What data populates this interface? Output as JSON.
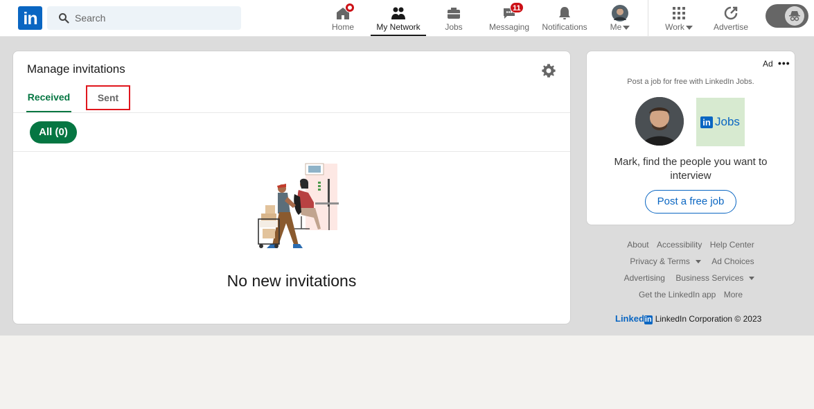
{
  "header": {
    "logo": "in",
    "search_placeholder": "Search",
    "nav": {
      "home": "Home",
      "network": "My Network",
      "jobs": "Jobs",
      "messaging": "Messaging",
      "messaging_badge": "11",
      "notifications": "Notifications",
      "me": "Me",
      "work": "Work",
      "advertise": "Advertise"
    }
  },
  "invitations": {
    "title": "Manage invitations",
    "tabs": [
      "Received",
      "Sent"
    ],
    "filter_pill": "All (0)",
    "empty_message": "No new invitations"
  },
  "ad": {
    "label": "Ad",
    "more": "•••",
    "subtitle": "Post a job for free with LinkedIn Jobs.",
    "jobs_logo_text": "Jobs",
    "message": "Mark, find the people you want to interview",
    "cta": "Post a free job"
  },
  "footer": {
    "links": [
      "About",
      "Accessibility",
      "Help Center",
      "Privacy & Terms",
      "Ad Choices",
      "Advertising",
      "Business Services",
      "Get the LinkedIn app",
      "More"
    ],
    "brand_word": "Linked",
    "brand_in": "in",
    "copyright": "LinkedIn Corporation © 2023"
  },
  "colors": {
    "brand": "#0a66c2",
    "accent_green": "#057642",
    "badge_red": "#cc1016",
    "highlight_box": "#e0161d"
  }
}
